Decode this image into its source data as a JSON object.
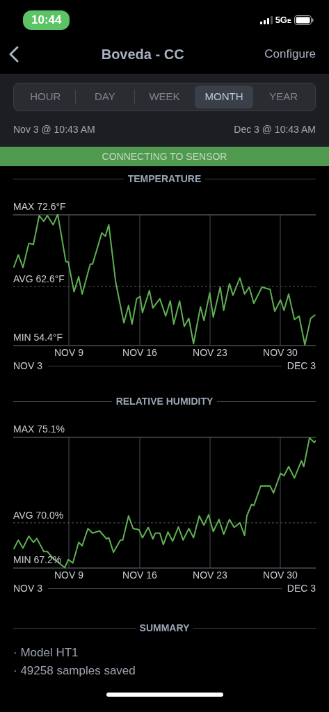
{
  "status_bar": {
    "time": "10:44",
    "network": "5G",
    "network_sub": "E"
  },
  "header": {
    "title": "Boveda - CC",
    "action": "Configure"
  },
  "periods": [
    {
      "label": "HOUR",
      "selected": false
    },
    {
      "label": "DAY",
      "selected": false
    },
    {
      "label": "WEEK",
      "selected": false
    },
    {
      "label": "MONTH",
      "selected": true
    },
    {
      "label": "YEAR",
      "selected": false
    }
  ],
  "range": {
    "start": "Nov 3 @ 10:43 AM",
    "end": "Dec 3 @ 10:43 AM"
  },
  "banner": "CONNECTING TO SENSOR",
  "charts": [
    {
      "title": "TEMPERATURE",
      "max_label": "MAX 72.6°F",
      "avg_label": "AVG 62.6°F",
      "min_label": "MIN 54.4°F",
      "ticks": [
        "NOV 9",
        "NOV 16",
        "NOV 23",
        "NOV 30"
      ],
      "start": "NOV 3",
      "end": "DEC 3"
    },
    {
      "title": "RELATIVE HUMIDITY",
      "max_label": "MAX 75.1%",
      "avg_label": "AVG 70.0%",
      "min_label": "MIN 67.2%",
      "ticks": [
        "NOV 9",
        "NOV 16",
        "NOV 23",
        "NOV 30"
      ],
      "start": "NOV 3",
      "end": "DEC 3"
    }
  ],
  "summary": {
    "title": "SUMMARY",
    "items": [
      "Model HT1",
      "49258 samples saved"
    ],
    "bullet": "·"
  }
}
